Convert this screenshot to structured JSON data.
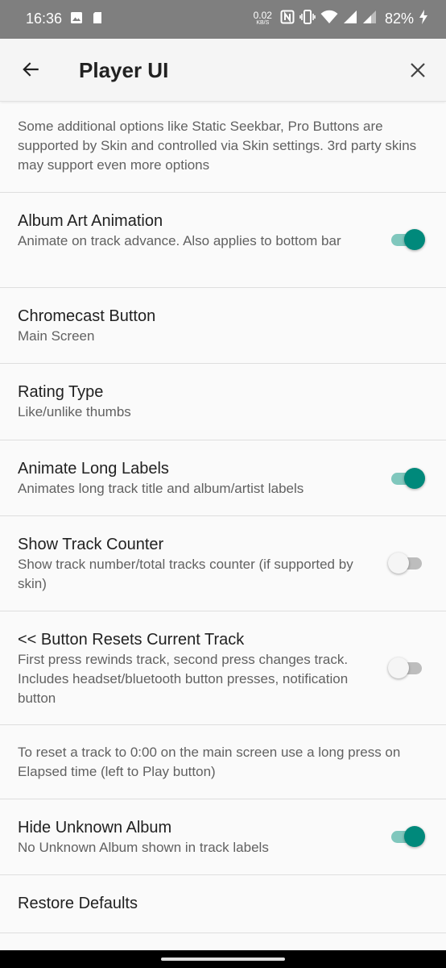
{
  "status_bar": {
    "time": "16:36",
    "net_speed": "0.02",
    "net_unit": "KB/S",
    "battery": "82%"
  },
  "app_bar": {
    "title": "Player UI"
  },
  "colors": {
    "accent": "#00897b",
    "accent_track": "#80c7bd"
  },
  "items": [
    {
      "type": "info",
      "text": "Some additional options like Static Seekbar, Pro Buttons are supported by Skin and controlled via Skin settings. 3rd party skins may support even more options"
    },
    {
      "type": "switch",
      "title": "Album Art Animation",
      "summary": "Animate on track advance. Also applies to bottom bar",
      "checked": true
    },
    {
      "type": "pref",
      "title": "Chromecast Button",
      "summary": "Main Screen"
    },
    {
      "type": "pref",
      "title": "Rating Type",
      "summary": "Like/unlike thumbs"
    },
    {
      "type": "switch",
      "title": "Animate Long Labels",
      "summary": "Animates long track title and album/artist labels",
      "checked": true
    },
    {
      "type": "switch",
      "title": "Show Track Counter",
      "summary": "Show track number/total tracks counter (if supported by skin)",
      "checked": false
    },
    {
      "type": "switch",
      "title": "<< Button Resets Current Track",
      "summary": "First press rewinds track, second press changes track. Includes headset/bluetooth button presses, notification button",
      "checked": false
    },
    {
      "type": "info",
      "text": "To reset a track to 0:00 on the main screen use a long press on Elapsed time (left to Play button)"
    },
    {
      "type": "switch",
      "title": "Hide Unknown Album",
      "summary": "No Unknown Album shown in track labels",
      "checked": true
    },
    {
      "type": "pref",
      "title": "Restore Defaults",
      "summary": ""
    }
  ]
}
